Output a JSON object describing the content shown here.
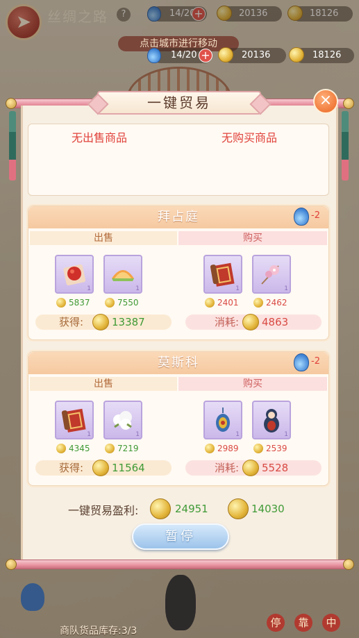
{
  "hud": {
    "title": "丝绸之路",
    "help_icon": "?",
    "stamina": "14/20",
    "coins": "20136",
    "gold": "18126"
  },
  "hint": "点击城市进行移动",
  "overlay_hud": {
    "stamina": "14/20",
    "coins": "20136",
    "gold": "18126"
  },
  "dialog": {
    "title": "一键贸易",
    "close_icon": "×",
    "summary": {
      "no_sell": "无出售商品",
      "no_buy": "无购买商品"
    },
    "sell_label": "出售",
    "buy_label": "购买",
    "gain_label": "获得:",
    "spend_label": "消耗:",
    "cities": [
      {
        "name": "拜占庭",
        "cost": "-2",
        "sell": [
          {
            "icon": "rose-cloth-icon",
            "qty": "1",
            "price": "5837"
          },
          {
            "icon": "melon-icon",
            "qty": "1",
            "price": "7550"
          }
        ],
        "buy": [
          {
            "icon": "carpet-icon",
            "qty": "1",
            "price": "2401"
          },
          {
            "icon": "flower-hairpin-icon",
            "qty": "1",
            "price": "2462"
          }
        ],
        "gain": "13387",
        "spend": "4863"
      },
      {
        "name": "莫斯科",
        "cost": "-2",
        "sell": [
          {
            "icon": "carpet-icon",
            "qty": "1",
            "price": "4345"
          },
          {
            "icon": "cotton-icon",
            "qty": "1",
            "price": "7219"
          }
        ],
        "buy": [
          {
            "icon": "pendant-icon",
            "qty": "1",
            "price": "2989"
          },
          {
            "icon": "matryoshka-icon",
            "qty": "1",
            "price": "2539"
          }
        ],
        "gain": "11564",
        "spend": "5528"
      }
    ],
    "profit_label": "一键贸易盈利:",
    "profit_coins": "24951",
    "profit_gold": "14030",
    "pause_label": "暂停"
  },
  "footer": {
    "stock_label": "商队货品库存:3/3",
    "stop_chars": [
      "停",
      "靠",
      "中"
    ]
  },
  "colors": {
    "accent_red": "#e0413b",
    "gain_green": "#3f9a36",
    "panel_bg": "#f7efe2",
    "rod_pink": "#e892a0"
  }
}
